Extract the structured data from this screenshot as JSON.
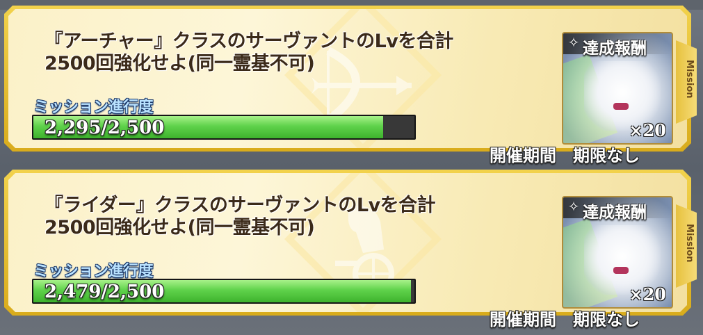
{
  "missions": [
    {
      "title_line1": "『アーチャー』クラスのサーヴァントのLvを合計",
      "title_line2": "2500回強化せよ(同一霊基不可)",
      "emblem": "archer-bow-icon",
      "progress_label": "ミッション進行度",
      "progress_text": "2,295/2,500",
      "progress_fraction": 0.918,
      "reward_label": "達成報酬",
      "reward_count": "×20",
      "side_label": "Mission",
      "period_label": "開催期間",
      "period_value": "期限なし"
    },
    {
      "title_line1": "『ライダー』クラスのサーヴァントのLvを合計",
      "title_line2": "2500回強化せよ(同一霊基不可)",
      "emblem": "rider-chariot-icon",
      "progress_label": "ミッション進行度",
      "progress_text": "2,479/2,500",
      "progress_fraction": 0.9916,
      "reward_label": "達成報酬",
      "reward_count": "×20",
      "side_label": "Mission",
      "period_label": "開催期間",
      "period_value": "期限なし"
    }
  ],
  "colors": {
    "frame_gold": "#e0b72a",
    "card_bg": "#fcf3cf",
    "bar_green": "#5fd24b",
    "bar_track": "#383838",
    "text_brown": "#3b2a19"
  }
}
